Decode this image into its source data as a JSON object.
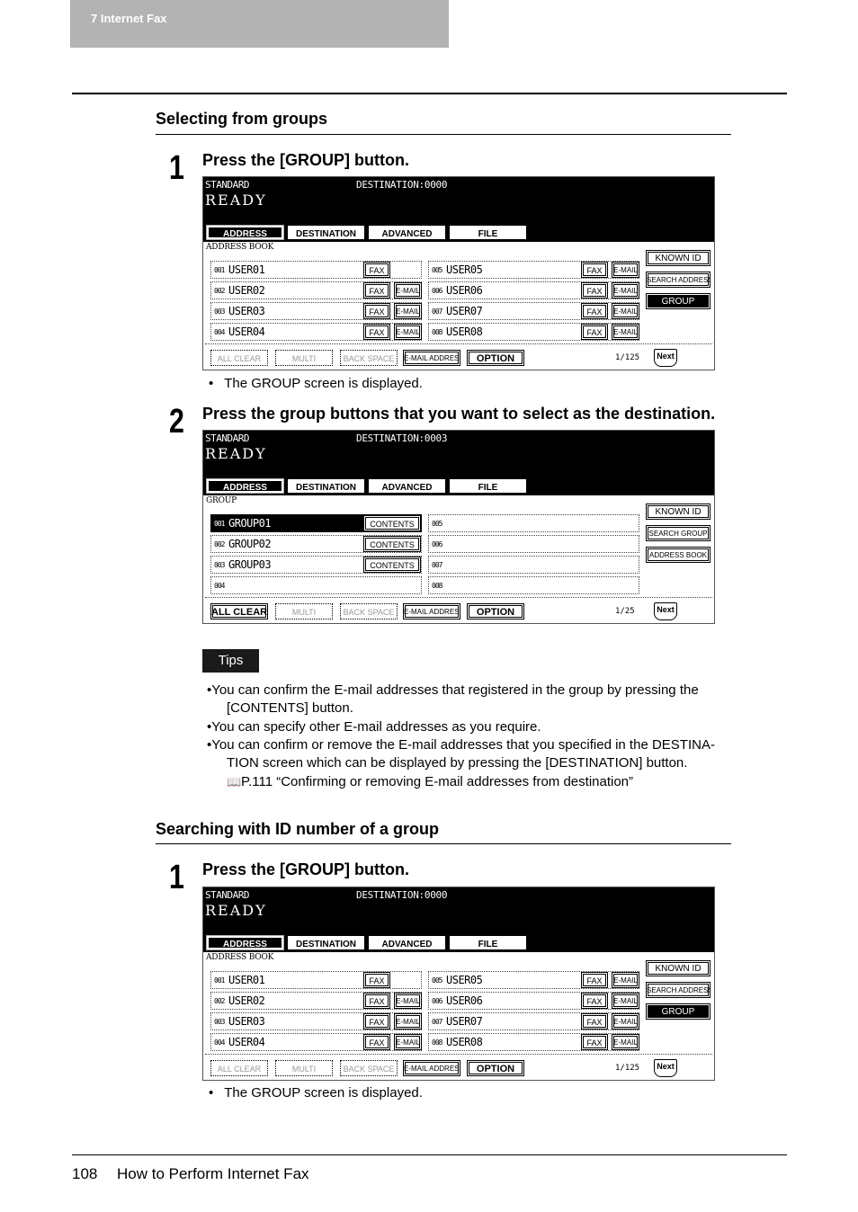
{
  "header": {
    "chapter": "7   Internet Fax"
  },
  "sections": [
    {
      "title": "Selecting from groups",
      "steps": [
        {
          "num": "1",
          "text": "Press the [GROUP] button.",
          "note": "The GROUP screen is displayed."
        },
        {
          "num": "2",
          "text": "Press the group buttons that you want to select as the destination."
        }
      ]
    },
    {
      "title": "Searching with ID number of a group",
      "steps": [
        {
          "num": "1",
          "text": "Press the [GROUP] button.",
          "note": "The GROUP screen is displayed."
        }
      ]
    }
  ],
  "bullet_char": "•",
  "screens": {
    "address": {
      "mode": "STANDARD",
      "destination": "DESTINATION:0000",
      "status": "READY",
      "tabs": [
        "ADDRESS",
        "DESTINATION",
        "ADVANCED",
        "FILE"
      ],
      "list_label": "ADDRESS BOOK",
      "entries": [
        {
          "num": "001",
          "name": "USER01",
          "fax": "FAX",
          "email": ""
        },
        {
          "num": "002",
          "name": "USER02",
          "fax": "FAX",
          "email": "E-MAIL"
        },
        {
          "num": "003",
          "name": "USER03",
          "fax": "FAX",
          "email": "E-MAIL"
        },
        {
          "num": "004",
          "name": "USER04",
          "fax": "FAX",
          "email": "E-MAIL"
        },
        {
          "num": "005",
          "name": "USER05",
          "fax": "FAX",
          "email": "E-MAIL"
        },
        {
          "num": "006",
          "name": "USER06",
          "fax": "FAX",
          "email": "E-MAIL"
        },
        {
          "num": "007",
          "name": "USER07",
          "fax": "FAX",
          "email": "E-MAIL"
        },
        {
          "num": "008",
          "name": "USER08",
          "fax": "FAX",
          "email": "E-MAIL"
        }
      ],
      "side_buttons": [
        "KNOWN ID",
        "SEARCH ADDRESS",
        "GROUP"
      ],
      "bottom_buttons": [
        "ALL CLEAR",
        "MULTI",
        "BACK SPACE",
        "E-MAIL ADDRESS",
        "OPTION"
      ],
      "page": "1/125",
      "next": "Next"
    },
    "group": {
      "mode": "STANDARD",
      "destination": "DESTINATION:0003",
      "status": "READY",
      "tabs": [
        "ADDRESS",
        "DESTINATION",
        "ADVANCED",
        "FILE"
      ],
      "list_label": "GROUP",
      "entries": [
        {
          "num": "001",
          "name": "GROUP01",
          "contents": "CONTENTS",
          "selected": true
        },
        {
          "num": "002",
          "name": "GROUP02",
          "contents": "CONTENTS"
        },
        {
          "num": "003",
          "name": "GROUP03",
          "contents": "CONTENTS"
        },
        {
          "num": "004",
          "name": "",
          "contents": ""
        },
        {
          "num": "005",
          "name": "",
          "contents": ""
        },
        {
          "num": "006",
          "name": "",
          "contents": ""
        },
        {
          "num": "007",
          "name": "",
          "contents": ""
        },
        {
          "num": "008",
          "name": "",
          "contents": ""
        }
      ],
      "side_buttons": [
        "KNOWN ID",
        "SEARCH GROUP",
        "ADDRESS BOOK"
      ],
      "bottom_buttons": [
        "ALL CLEAR",
        "MULTI",
        "BACK SPACE",
        "E-MAIL ADDRESS",
        "OPTION"
      ],
      "page": "1/25",
      "next": "Next"
    }
  },
  "tips": {
    "label": "Tips",
    "items": [
      {
        "line1": "•You can confirm the E-mail addresses that registered in the group by pressing the",
        "line2": "[CONTENTS] button."
      },
      {
        "line1": "•You can specify other E-mail addresses as you require."
      },
      {
        "line1": "•You can confirm or remove the E-mail addresses that you specified in the DESTINA-",
        "line2": "TION screen which can be displayed by pressing the [DESTINATION] button."
      }
    ],
    "reference": "P.111 “Confirming or removing E-mail addresses from destination”"
  },
  "footer": {
    "page_number": "108",
    "title": "How to Perform Internet Fax"
  }
}
